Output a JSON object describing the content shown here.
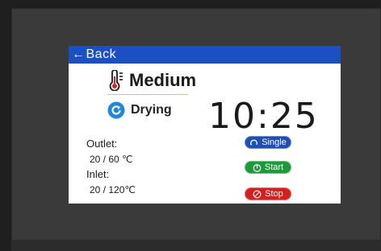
{
  "topbar": {
    "back_label": "Back"
  },
  "temperature": {
    "level": "Medium"
  },
  "mode": {
    "label": "Drying"
  },
  "clock": {
    "time": "10:25"
  },
  "outlet": {
    "label": "Outlet:",
    "value": "20 /  60 ℃"
  },
  "inlet": {
    "label": "Inlet:",
    "value": "20 /  120℃"
  },
  "buttons": {
    "single": "Single",
    "start": "Start",
    "stop": "Stop"
  },
  "colors": {
    "topbar": "#1b4fc2",
    "single": "#1e4fb4",
    "start": "#1f9a3a",
    "stop": "#d51f1f"
  },
  "icons": {
    "back": "left-arrow-icon",
    "temperature": "thermometer-icon",
    "mode": "refresh-icon",
    "single": "cycle-icon",
    "start": "power-icon",
    "stop": "prohibited-icon"
  }
}
